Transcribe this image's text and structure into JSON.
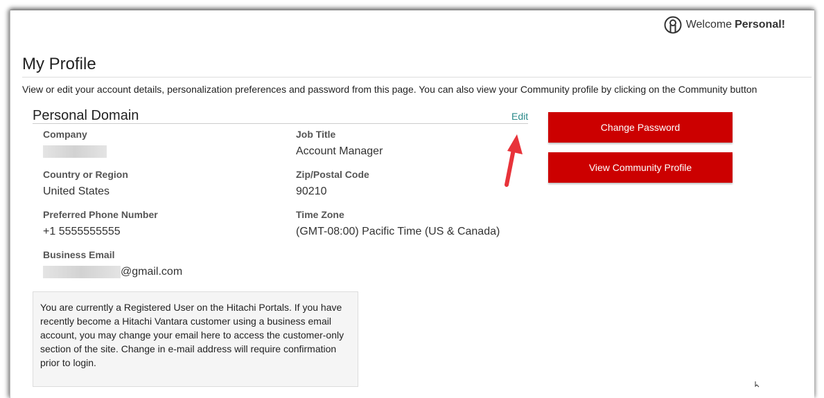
{
  "header": {
    "welcome_prefix": "Welcome",
    "user_name": "Personal!"
  },
  "page": {
    "title": "My Profile",
    "intro": "View or edit your account details, personalization preferences and password from this page. You can also view your Community profile by clicking on the Community button"
  },
  "section": {
    "title": "Personal Domain",
    "edit_label": "Edit"
  },
  "fields": {
    "company": {
      "label": "Company",
      "value": ""
    },
    "job_title": {
      "label": "Job Title",
      "value": "Account Manager"
    },
    "country": {
      "label": "Country or Region",
      "value": "United States"
    },
    "zip": {
      "label": "Zip/Postal Code",
      "value": "90210"
    },
    "phone": {
      "label": "Preferred Phone Number",
      "value": "+1 5555555555"
    },
    "timezone": {
      "label": "Time Zone",
      "value": "(GMT-08:00) Pacific Time (US & Canada)"
    },
    "email": {
      "label": "Business Email",
      "value_suffix": "@gmail.com"
    }
  },
  "actions": {
    "change_password": "Change Password",
    "view_community": "View Community Profile"
  },
  "notice": {
    "text": "You are currently a Registered User on the Hitachi Portals. If you have recently become a Hitachi Vantara customer using a business email account, you may change your email here to access the customer-only section of the site. Change in e-mail address will require confirmation prior to login."
  },
  "colors": {
    "button_red": "#cc0000",
    "edit_link": "#2a8a8a",
    "annotation_arrow": "#e8333a"
  }
}
